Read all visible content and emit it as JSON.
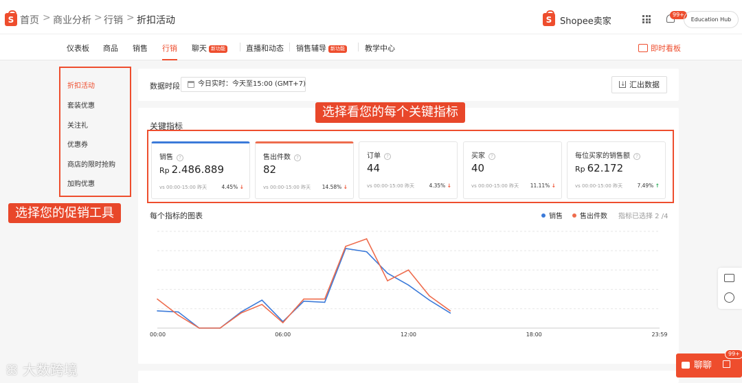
{
  "breadcrumb": {
    "items": [
      "首页",
      "商业分析",
      "行销",
      "折扣活动"
    ],
    "separator": ">"
  },
  "header": {
    "seller_title": "Shopee卖家",
    "notification_badge": "99+",
    "education_hub": "Education Hub"
  },
  "nav": {
    "tabs": [
      {
        "label": "仪表板",
        "active": false
      },
      {
        "label": "商品",
        "active": false
      },
      {
        "label": "销售",
        "active": false
      },
      {
        "label": "行销",
        "active": true
      },
      {
        "label": "聊天",
        "active": false,
        "tag": "新功能"
      },
      {
        "label": "直播和动态",
        "active": false
      },
      {
        "label": "销售辅导",
        "active": false,
        "tag": "新功能"
      },
      {
        "label": "教学中心",
        "active": false
      }
    ],
    "realtime_dashboard": "即时看板"
  },
  "sidebar": {
    "items": [
      {
        "label": "折扣活动",
        "active": true
      },
      {
        "label": "套装优惠",
        "active": false
      },
      {
        "label": "关注礼",
        "active": false
      },
      {
        "label": "优惠券",
        "active": false
      },
      {
        "label": "商店的限时抢购",
        "active": false
      },
      {
        "label": "加购优惠",
        "active": false
      }
    ]
  },
  "annotations": {
    "promo_tool": "选择您的促销工具",
    "key_metrics": "选择看您的每个关键指标"
  },
  "filter": {
    "period_label": "数据时段",
    "period_value": "今日实时：今天至15:00 (GMT+7)",
    "export": "汇出数据"
  },
  "key_metrics": {
    "title": "关键指标",
    "items": [
      {
        "name": "销售",
        "currency": "Rp",
        "value": "2.486.889",
        "compare": "vs 00:00-15:00 昨天",
        "change": "4.45%",
        "trend": "down",
        "selected": "blue"
      },
      {
        "name": "售出件数",
        "currency": "",
        "value": "82",
        "compare": "vs 00:00-15:00 昨天",
        "change": "14.58%",
        "trend": "down",
        "selected": "orange"
      },
      {
        "name": "订单",
        "currency": "",
        "value": "44",
        "compare": "vs 00:00-15:00 昨天",
        "change": "4.35%",
        "trend": "down",
        "selected": ""
      },
      {
        "name": "买家",
        "currency": "",
        "value": "40",
        "compare": "vs 00:00-15:00 昨天",
        "change": "11.11%",
        "trend": "down",
        "selected": ""
      },
      {
        "name": "每位买家的销售额",
        "currency": "Rp",
        "value": "62.172",
        "compare": "vs 00:00-15:00 昨天",
        "change": "7.49%",
        "trend": "up",
        "selected": ""
      }
    ]
  },
  "chart_section": {
    "title": "每个指标的图表",
    "selected_count": "指标已选择 2 /4"
  },
  "colors": {
    "brand": "#ee4d2d",
    "series_sales": "#3b7ad9",
    "series_units": "#ee6c4d"
  },
  "chart_data": {
    "type": "line",
    "x": [
      0,
      1,
      2,
      3,
      4,
      5,
      6,
      7,
      8,
      9,
      10,
      11,
      12,
      13,
      14
    ],
    "xticks": [
      "00:00",
      "06:00",
      "12:00",
      "18:00",
      "23:59"
    ],
    "xtick_hours": [
      0,
      6,
      12,
      18,
      24
    ],
    "xlim": [
      0,
      24
    ],
    "ylim": [
      0,
      9
    ],
    "grid": true,
    "legend_position": "top-right",
    "series": [
      {
        "name": "销售",
        "color": "#3b7ad9",
        "values": [
          1.6,
          1.5,
          0,
          0,
          1.5,
          2.6,
          0.6,
          2.5,
          2.4,
          7.4,
          7.1,
          5.1,
          4.0,
          2.6,
          1.4
        ]
      },
      {
        "name": "售出件数",
        "color": "#ee6c4d",
        "values": [
          2.7,
          1.2,
          0,
          0,
          1.4,
          2.2,
          0.5,
          2.7,
          2.7,
          7.6,
          8.3,
          4.4,
          5.4,
          3.0,
          1.6
        ]
      }
    ]
  }
}
